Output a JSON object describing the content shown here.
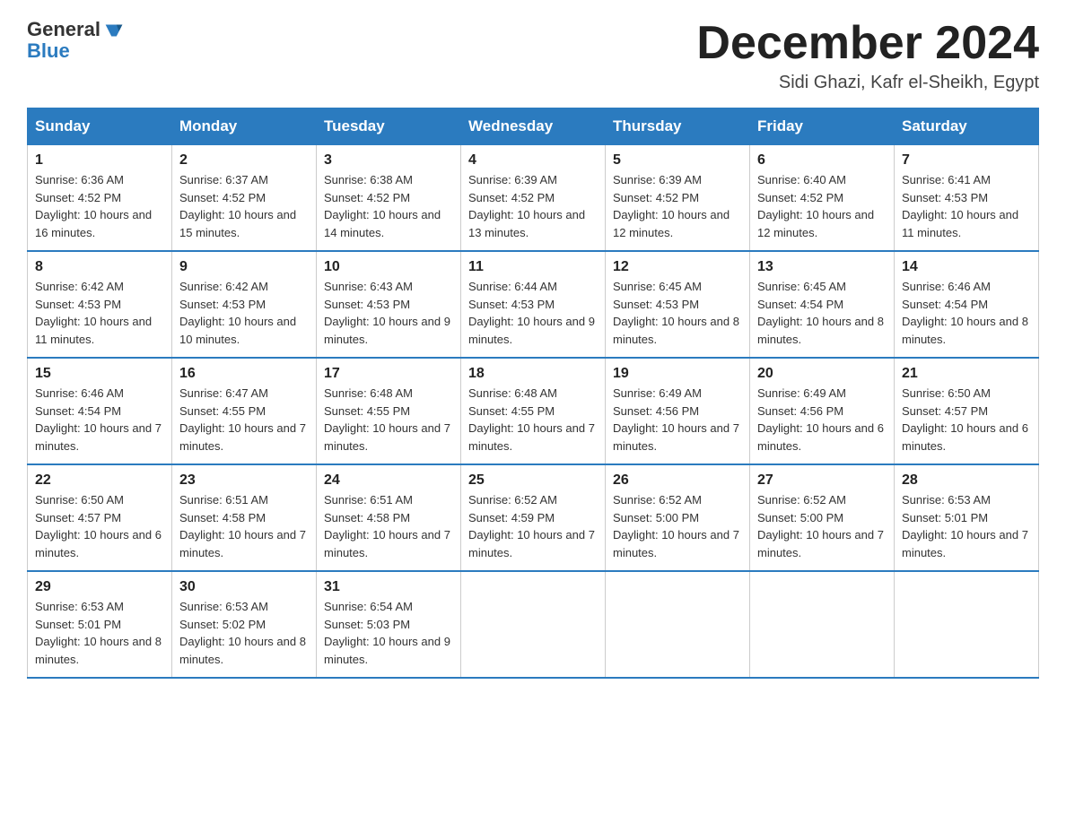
{
  "header": {
    "logo_text_black": "General",
    "logo_text_blue": "Blue",
    "month_year": "December 2024",
    "location": "Sidi Ghazi, Kafr el-Sheikh, Egypt"
  },
  "days_of_week": [
    "Sunday",
    "Monday",
    "Tuesday",
    "Wednesday",
    "Thursday",
    "Friday",
    "Saturday"
  ],
  "weeks": [
    [
      {
        "day": 1,
        "sunrise": "6:36 AM",
        "sunset": "4:52 PM",
        "daylight": "10 hours and 16 minutes."
      },
      {
        "day": 2,
        "sunrise": "6:37 AM",
        "sunset": "4:52 PM",
        "daylight": "10 hours and 15 minutes."
      },
      {
        "day": 3,
        "sunrise": "6:38 AM",
        "sunset": "4:52 PM",
        "daylight": "10 hours and 14 minutes."
      },
      {
        "day": 4,
        "sunrise": "6:39 AM",
        "sunset": "4:52 PM",
        "daylight": "10 hours and 13 minutes."
      },
      {
        "day": 5,
        "sunrise": "6:39 AM",
        "sunset": "4:52 PM",
        "daylight": "10 hours and 12 minutes."
      },
      {
        "day": 6,
        "sunrise": "6:40 AM",
        "sunset": "4:52 PM",
        "daylight": "10 hours and 12 minutes."
      },
      {
        "day": 7,
        "sunrise": "6:41 AM",
        "sunset": "4:53 PM",
        "daylight": "10 hours and 11 minutes."
      }
    ],
    [
      {
        "day": 8,
        "sunrise": "6:42 AM",
        "sunset": "4:53 PM",
        "daylight": "10 hours and 11 minutes."
      },
      {
        "day": 9,
        "sunrise": "6:42 AM",
        "sunset": "4:53 PM",
        "daylight": "10 hours and 10 minutes."
      },
      {
        "day": 10,
        "sunrise": "6:43 AM",
        "sunset": "4:53 PM",
        "daylight": "10 hours and 9 minutes."
      },
      {
        "day": 11,
        "sunrise": "6:44 AM",
        "sunset": "4:53 PM",
        "daylight": "10 hours and 9 minutes."
      },
      {
        "day": 12,
        "sunrise": "6:45 AM",
        "sunset": "4:53 PM",
        "daylight": "10 hours and 8 minutes."
      },
      {
        "day": 13,
        "sunrise": "6:45 AM",
        "sunset": "4:54 PM",
        "daylight": "10 hours and 8 minutes."
      },
      {
        "day": 14,
        "sunrise": "6:46 AM",
        "sunset": "4:54 PM",
        "daylight": "10 hours and 8 minutes."
      }
    ],
    [
      {
        "day": 15,
        "sunrise": "6:46 AM",
        "sunset": "4:54 PM",
        "daylight": "10 hours and 7 minutes."
      },
      {
        "day": 16,
        "sunrise": "6:47 AM",
        "sunset": "4:55 PM",
        "daylight": "10 hours and 7 minutes."
      },
      {
        "day": 17,
        "sunrise": "6:48 AM",
        "sunset": "4:55 PM",
        "daylight": "10 hours and 7 minutes."
      },
      {
        "day": 18,
        "sunrise": "6:48 AM",
        "sunset": "4:55 PM",
        "daylight": "10 hours and 7 minutes."
      },
      {
        "day": 19,
        "sunrise": "6:49 AM",
        "sunset": "4:56 PM",
        "daylight": "10 hours and 7 minutes."
      },
      {
        "day": 20,
        "sunrise": "6:49 AM",
        "sunset": "4:56 PM",
        "daylight": "10 hours and 6 minutes."
      },
      {
        "day": 21,
        "sunrise": "6:50 AM",
        "sunset": "4:57 PM",
        "daylight": "10 hours and 6 minutes."
      }
    ],
    [
      {
        "day": 22,
        "sunrise": "6:50 AM",
        "sunset": "4:57 PM",
        "daylight": "10 hours and 6 minutes."
      },
      {
        "day": 23,
        "sunrise": "6:51 AM",
        "sunset": "4:58 PM",
        "daylight": "10 hours and 7 minutes."
      },
      {
        "day": 24,
        "sunrise": "6:51 AM",
        "sunset": "4:58 PM",
        "daylight": "10 hours and 7 minutes."
      },
      {
        "day": 25,
        "sunrise": "6:52 AM",
        "sunset": "4:59 PM",
        "daylight": "10 hours and 7 minutes."
      },
      {
        "day": 26,
        "sunrise": "6:52 AM",
        "sunset": "5:00 PM",
        "daylight": "10 hours and 7 minutes."
      },
      {
        "day": 27,
        "sunrise": "6:52 AM",
        "sunset": "5:00 PM",
        "daylight": "10 hours and 7 minutes."
      },
      {
        "day": 28,
        "sunrise": "6:53 AM",
        "sunset": "5:01 PM",
        "daylight": "10 hours and 7 minutes."
      }
    ],
    [
      {
        "day": 29,
        "sunrise": "6:53 AM",
        "sunset": "5:01 PM",
        "daylight": "10 hours and 8 minutes."
      },
      {
        "day": 30,
        "sunrise": "6:53 AM",
        "sunset": "5:02 PM",
        "daylight": "10 hours and 8 minutes."
      },
      {
        "day": 31,
        "sunrise": "6:54 AM",
        "sunset": "5:03 PM",
        "daylight": "10 hours and 9 minutes."
      },
      null,
      null,
      null,
      null
    ]
  ]
}
